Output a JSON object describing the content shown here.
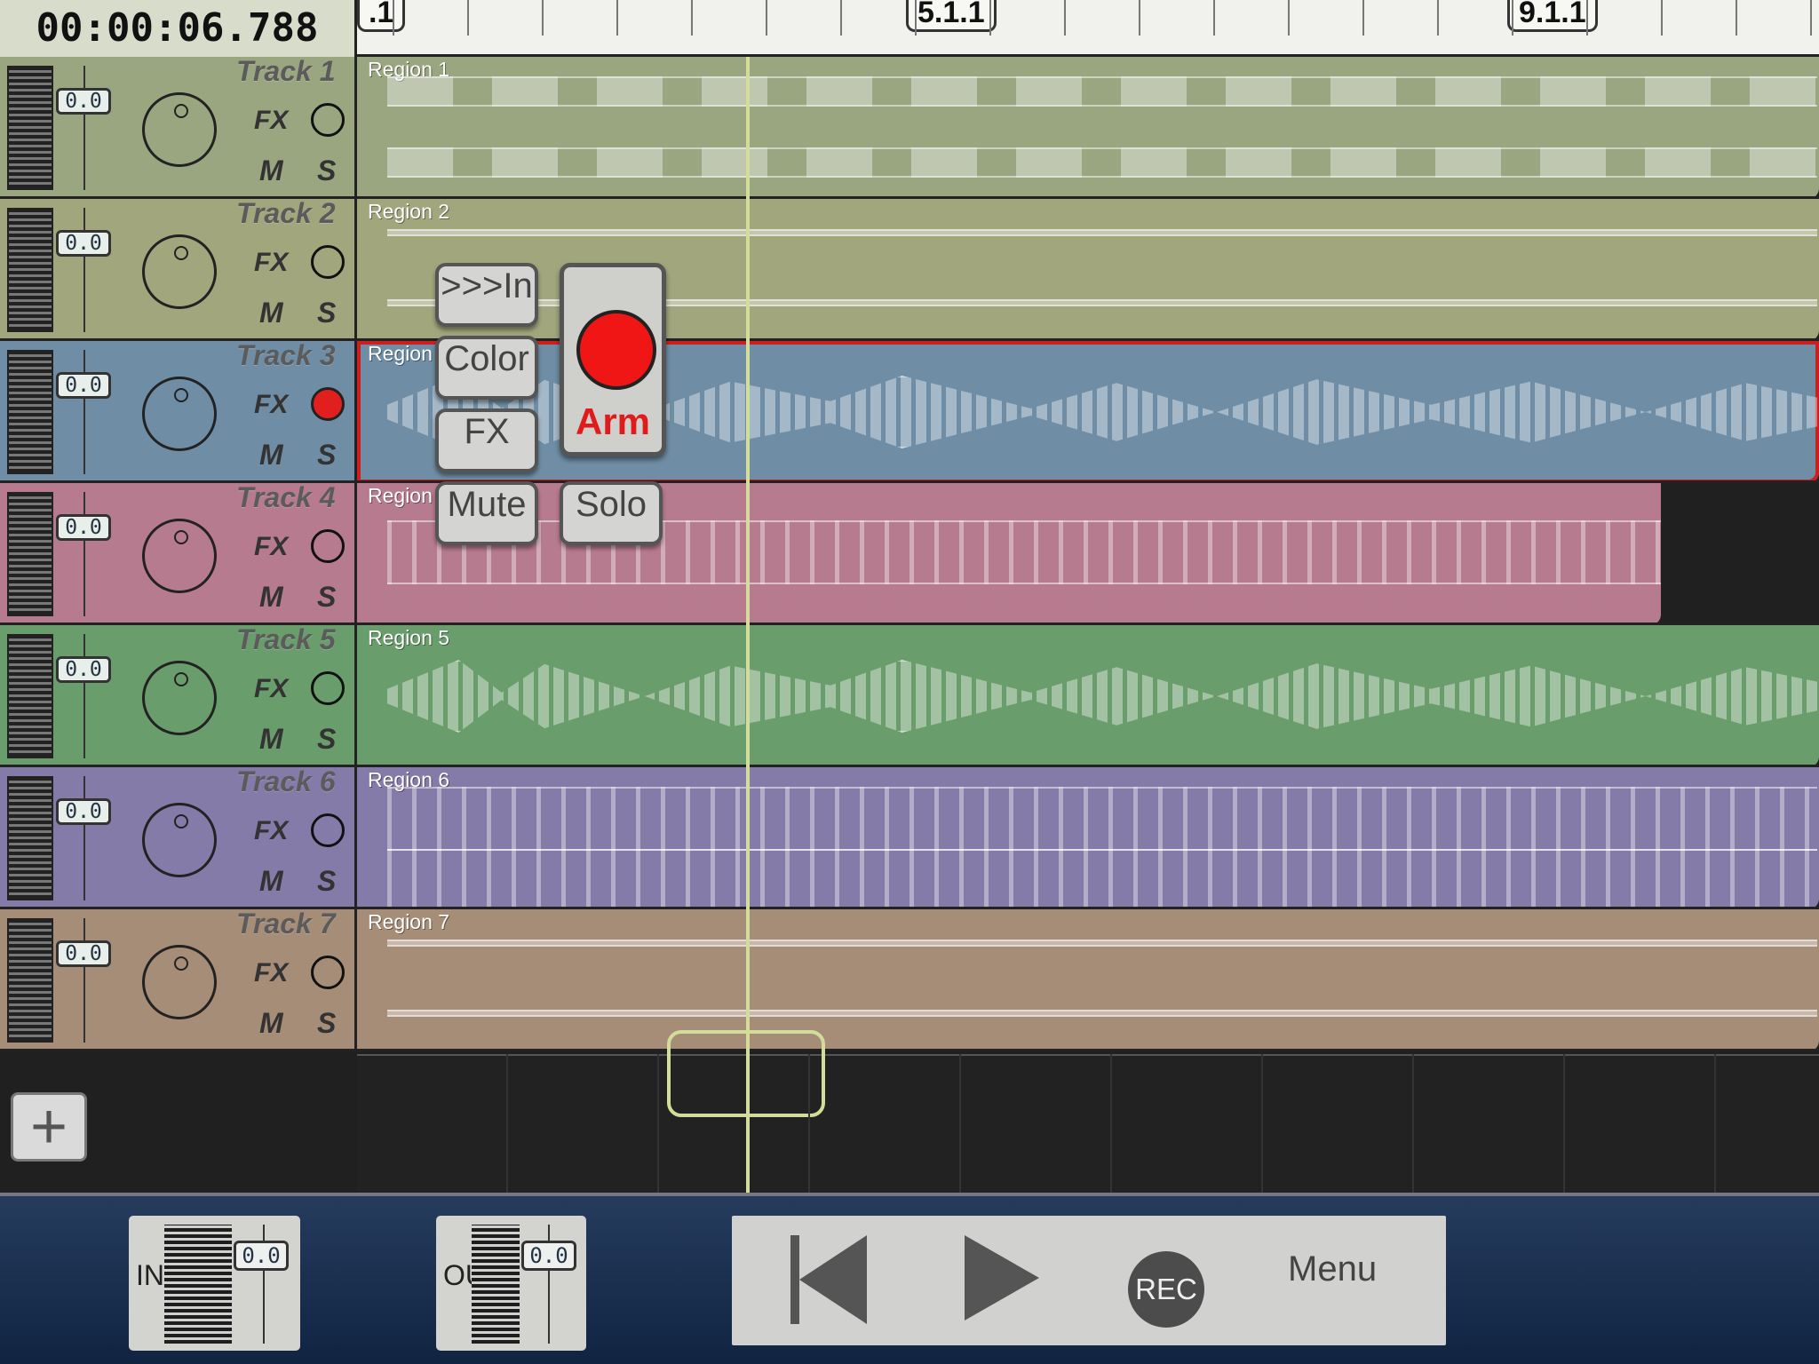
{
  "time": "00:00:06.788",
  "ruler_marks": [
    ".1",
    "5.1.1",
    "9.1.1"
  ],
  "tracks": [
    {
      "name": "Track 1",
      "region": "Region 1",
      "volume": "0.0",
      "color": "#9aa680",
      "wave": "cut"
    },
    {
      "name": "Track 2",
      "region": "Region 2",
      "volume": "0.0",
      "color": "#a1a67d",
      "wave": "line"
    },
    {
      "name": "Track 3",
      "region": "Region",
      "volume": "0.0",
      "color": "#6f8ea5",
      "wave": "big",
      "armed": true
    },
    {
      "name": "Track 4",
      "region": "Region",
      "volume": "0.0",
      "color": "#b77b8f",
      "wave": "spiky"
    },
    {
      "name": "Track 5",
      "region": "Region 5",
      "volume": "0.0",
      "color": "#6a9d6c",
      "wave": "big"
    },
    {
      "name": "Track 6",
      "region": "Region 6",
      "volume": "0.0",
      "color": "#857ba8",
      "wave": "spiky"
    },
    {
      "name": "Track 7",
      "region": "Region 7",
      "volume": "0.0",
      "color": "#a68d78",
      "wave": "line"
    }
  ],
  "track_buttons": {
    "fx": "FX",
    "mute": "M",
    "solo": "S"
  },
  "context_menu": {
    "input": ">>>In",
    "color": "Color",
    "fx": "FX",
    "arm": "Arm",
    "mute": "Mute",
    "solo": "Solo"
  },
  "bottom": {
    "in_label": "IN",
    "out_label": "OUT",
    "in_value": "0.0",
    "out_value": "0.0",
    "rec": "REC",
    "menu": "Menu",
    "add": "+"
  }
}
